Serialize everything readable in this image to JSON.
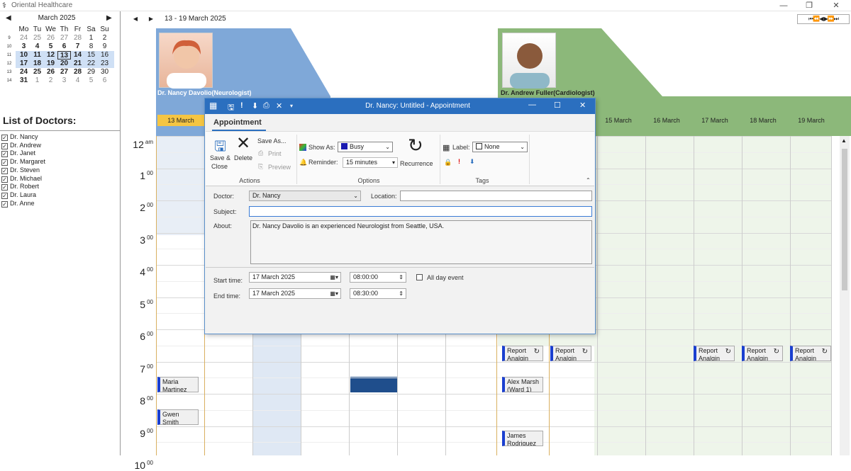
{
  "window": {
    "title": "Oriental Healthcare",
    "minimize": "—",
    "maximize": "❐",
    "close": "✕"
  },
  "calendar": {
    "month_label": "March  2025",
    "prev": "◀",
    "next": "▶",
    "weekdays": [
      "Mo",
      "Tu",
      "We",
      "Th",
      "Fr",
      "Sa",
      "Su"
    ],
    "weeks": [
      {
        "num": "9",
        "days": [
          "24",
          "25",
          "26",
          "27",
          "28",
          "1",
          "2"
        ]
      },
      {
        "num": "10",
        "days": [
          "3",
          "4",
          "5",
          "6",
          "7",
          "8",
          "9"
        ]
      },
      {
        "num": "11",
        "days": [
          "10",
          "11",
          "12",
          "13",
          "14",
          "15",
          "16"
        ]
      },
      {
        "num": "12",
        "days": [
          "17",
          "18",
          "19",
          "20",
          "21",
          "22",
          "23"
        ]
      },
      {
        "num": "13",
        "days": [
          "24",
          "25",
          "26",
          "27",
          "28",
          "29",
          "30"
        ]
      },
      {
        "num": "14",
        "days": [
          "31",
          "1",
          "2",
          "3",
          "4",
          "5",
          "6"
        ]
      }
    ]
  },
  "doctor_list": {
    "title": "List of Doctors:",
    "items": [
      "Dr. Nancy",
      "Dr. Andrew",
      "Dr. Janet",
      "Dr. Margaret",
      "Dr. Steven",
      "Dr. Michael",
      "Dr. Robert",
      "Dr. Laura",
      "Dr. Anne"
    ]
  },
  "scheduler": {
    "range": "13 - 19 March 2025",
    "prev": "◀",
    "next": "▶",
    "nav_cluster": "⏮⏪◀ ▶⏩⏭",
    "times": [
      {
        "h": "12",
        "s": "am"
      },
      {
        "h": "1",
        "s": "00"
      },
      {
        "h": "2",
        "s": "00"
      },
      {
        "h": "3",
        "s": "00"
      },
      {
        "h": "4",
        "s": "00"
      },
      {
        "h": "5",
        "s": "00"
      },
      {
        "h": "6",
        "s": "00"
      },
      {
        "h": "7",
        "s": "00"
      },
      {
        "h": "8",
        "s": "00"
      },
      {
        "h": "9",
        "s": "00"
      },
      {
        "h": "10",
        "s": "00"
      }
    ],
    "res1": {
      "name": "Dr. Nancy Davolio(Neurologist)",
      "days": [
        "13 March"
      ]
    },
    "res2": {
      "name": "Dr. Andrew Fuller(Cardiologist)",
      "days": [
        "15 March",
        "16 March",
        "17 March",
        "18 March",
        "19 March"
      ]
    },
    "appointments": [
      {
        "l1": "Maria",
        "l2": "Martinez"
      },
      {
        "l1": "Gwen",
        "l2": "Smith"
      },
      {
        "l1": "Report",
        "l2": "Analgin"
      },
      {
        "l1": "Report",
        "l2": "Analgin"
      },
      {
        "l1": "Alex Marsh",
        "l2": "(Ward 1)"
      },
      {
        "l1": "James",
        "l2": "Rodriguez"
      },
      {
        "l1": "Report",
        "l2": "Analgin"
      },
      {
        "l1": "Report",
        "l2": "Analgin"
      },
      {
        "l1": "Report",
        "l2": "Analgin"
      }
    ]
  },
  "dialog": {
    "title": "Dr. Nancy: Untitled - Appointment",
    "tab": "Appointment",
    "actions": {
      "save_close_1": "Save &",
      "save_close_2": "Close",
      "delete": "Delete",
      "save_as": "Save As...",
      "print": "Print",
      "preview": "Preview",
      "group": "Actions"
    },
    "options": {
      "show_as_label": "Show As:",
      "show_as_value": "Busy",
      "reminder_label": "Reminder:",
      "reminder_value": "15 minutes",
      "recurrence": "Recurrence",
      "group": "Options"
    },
    "tags": {
      "label_label": "Label:",
      "label_value": "None",
      "group": "Tags"
    },
    "doctor_label": "Doctor:",
    "doctor_value": "Dr. Nancy",
    "location_label": "Location:",
    "location_value": "",
    "subject_label": "Subject:",
    "subject_value": "",
    "about_label": "About:",
    "about_value": "Dr. Nancy Davolio is an experienced Neurologist from Seattle, USA.",
    "start_label": "Start time:",
    "start_date": "17   March   2025",
    "start_time": "08:00:00",
    "end_label": "End time:",
    "end_date": "17   March   2025",
    "end_time": "08:30:00",
    "all_day": "All day event"
  },
  "colors": {
    "accent": "#2b6fbf",
    "res1": "#7fa8d8",
    "res2": "#8cb87a",
    "appt_border": "#1a3fd0"
  }
}
